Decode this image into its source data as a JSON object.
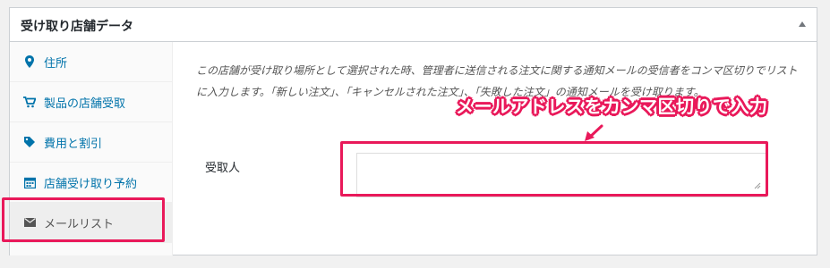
{
  "panel": {
    "title": "受け取り店舗データ"
  },
  "tabs": [
    {
      "label": "住所",
      "icon": "location-pin-icon"
    },
    {
      "label": "製品の店舗受取",
      "icon": "cart-icon"
    },
    {
      "label": "費用と割引",
      "icon": "tag-icon"
    },
    {
      "label": "店舗受け取り予約",
      "icon": "calendar-icon"
    },
    {
      "label": "メールリスト",
      "icon": "envelope-icon"
    }
  ],
  "email_section": {
    "description": "この店舗が受け取り場所として選択された時、管理者に送信される注文に関する通知メールの受信者をコンマ区切りでリストに入力します。「新しい注文」、「キャンセルされた注文」、「失敗した注文」の通知メールを受け取ります。",
    "recipient_label": "受取人",
    "recipient_value": ""
  },
  "annotation": {
    "callout": "メールアドレスをカンマ区切りで入力"
  },
  "colors": {
    "link": "#0073aa",
    "highlight": "#e9195a",
    "border": "#ccd0d4"
  }
}
